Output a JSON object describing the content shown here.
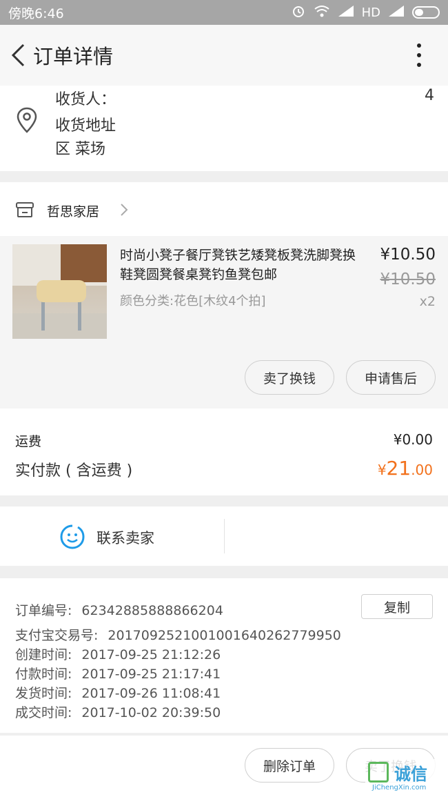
{
  "status_bar": {
    "time": "傍晚6:46",
    "network": "HD"
  },
  "navbar": {
    "title": "订单详情"
  },
  "address": {
    "receiver_label": "收货人：",
    "receiver_tail": "4",
    "address_label": "收货地址",
    "address_line2": "区  菜场"
  },
  "shop": {
    "name": "哲思家居"
  },
  "item": {
    "title": "时尚小凳子餐厅凳铁艺矮凳板凳洗脚凳换鞋凳圆凳餐桌凳钓鱼凳包邮",
    "sku": "颜色分类:花色[木纹4个拍]",
    "price": "¥10.50",
    "original_price": "¥10.50",
    "quantity": "x2",
    "btn_sell": "卖了换钱",
    "btn_after_sale": "申请售后"
  },
  "fees": {
    "shipping_label": "运费",
    "shipping_value": "¥0.00",
    "paid_label": "实付款 ( 含运费 )",
    "paid_currency": "¥",
    "paid_int": "21",
    "paid_dec": ".00",
    "paid_color": "#f2711c"
  },
  "contact": {
    "label": "联系卖家"
  },
  "order_info": {
    "order_no_label": "订单编号:",
    "order_no": "62342885888866204",
    "copy_label": "复制",
    "alipay_label": "支付宝交易号:",
    "alipay_no": "2017092521001001640262779950",
    "created_label": "创建时间:",
    "created": "2017-09-25 21:12:26",
    "paid_time_label": "付款时间:",
    "paid_time": "2017-09-25 21:17:41",
    "shipped_label": "发货时间:",
    "shipped": "2017-09-26 11:08:41",
    "done_label": "成交时间:",
    "done": "2017-10-02 20:39:50"
  },
  "bottom_bar": {
    "delete_label": "删除订单",
    "sell_label": "卖了换钱"
  },
  "watermark": {
    "text": "诚信",
    "sub": "JiChengXin.com"
  }
}
